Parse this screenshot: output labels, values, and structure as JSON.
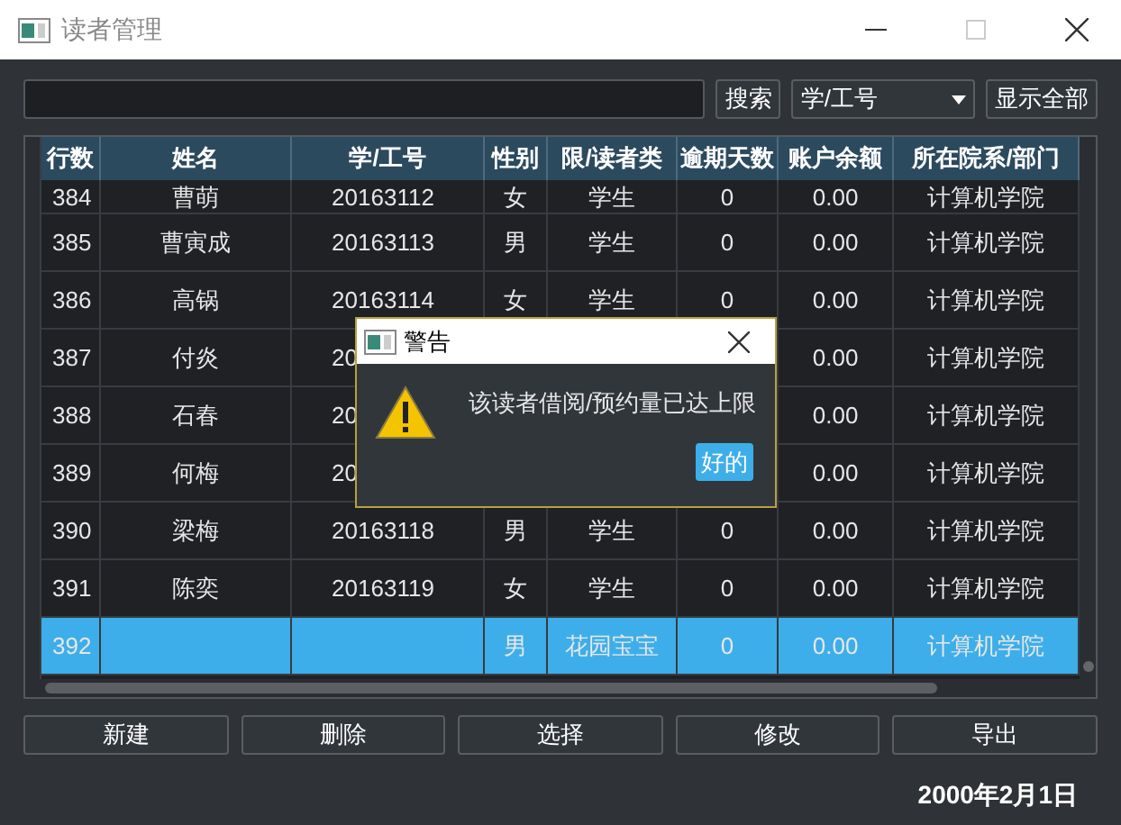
{
  "window": {
    "title": "读者管理"
  },
  "search": {
    "button": "搜索",
    "field_selector": "学/工号",
    "show_all": "显示全部"
  },
  "table": {
    "columns": [
      "行数",
      "姓名",
      "学/工号",
      "性别",
      "限/读者类",
      "逾期天数",
      "账户余额",
      "所在院系/部门"
    ],
    "rows": [
      {
        "selected": false,
        "cells": [
          "384",
          "曹萌",
          "20163112",
          "女",
          "学生",
          "0",
          "0.00",
          "计算机学院"
        ]
      },
      {
        "selected": false,
        "cells": [
          "385",
          "曹寅成",
          "20163113",
          "男",
          "学生",
          "0",
          "0.00",
          "计算机学院"
        ]
      },
      {
        "selected": false,
        "cells": [
          "386",
          "高锅",
          "20163114",
          "女",
          "学生",
          "0",
          "0.00",
          "计算机学院"
        ]
      },
      {
        "selected": false,
        "cells": [
          "387",
          "付炎",
          "20",
          null,
          null,
          null,
          "0.00",
          "计算机学院"
        ]
      },
      {
        "selected": false,
        "cells": [
          "388",
          "石春",
          "20",
          null,
          null,
          null,
          "0.00",
          "计算机学院"
        ]
      },
      {
        "selected": false,
        "cells": [
          "389",
          "何梅",
          "20",
          null,
          null,
          null,
          "0.00",
          "计算机学院"
        ]
      },
      {
        "selected": false,
        "cells": [
          "390",
          "梁梅",
          "20163118",
          "男",
          "学生",
          "0",
          "0.00",
          "计算机学院"
        ]
      },
      {
        "selected": false,
        "cells": [
          "391",
          "陈奕",
          "20163119",
          "女",
          "学生",
          "0",
          "0.00",
          "计算机学院"
        ]
      },
      {
        "selected": true,
        "cells": [
          "392",
          null,
          null,
          "男",
          "花园宝宝",
          "0",
          "0.00",
          "计算机学院"
        ]
      }
    ]
  },
  "buttons": [
    "新建",
    "删除",
    "选择",
    "修改",
    "导出"
  ],
  "date": "2000年2月1日",
  "dialog": {
    "title": "警告",
    "message": "该读者借阅/预约量已达上限",
    "button": "好的"
  }
}
